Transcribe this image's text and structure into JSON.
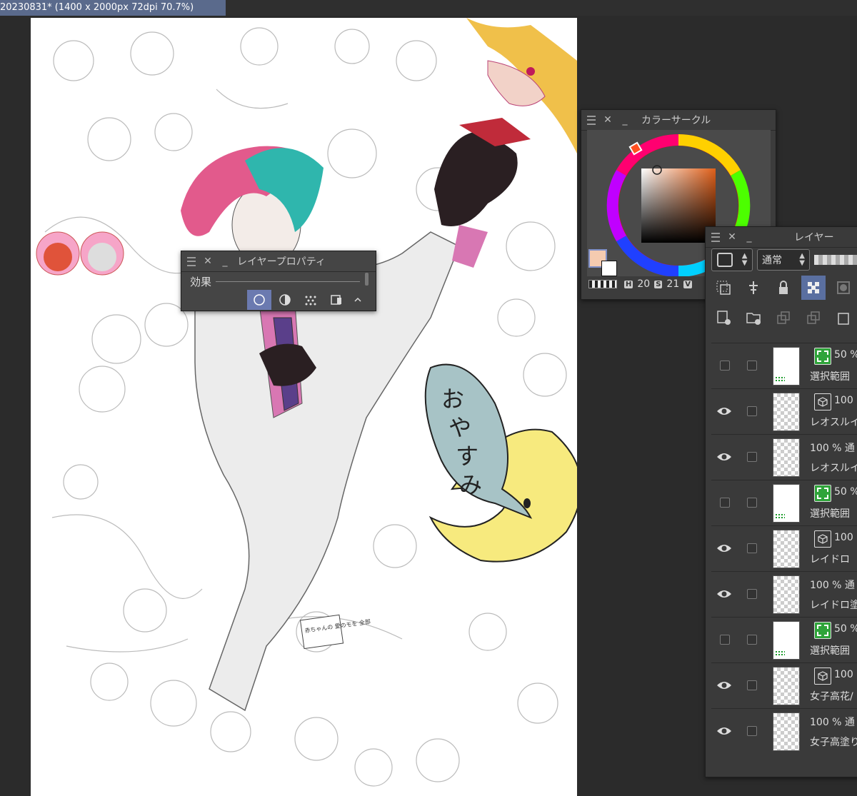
{
  "document": {
    "tab_title": "20230831* (1400 x 2000px 72dpi 70.7%)"
  },
  "canvas": {
    "speech_bubble_text": [
      "お",
      "や",
      "す",
      "み"
    ],
    "sign_text": "赤ちゃんの 愛のモを 全部"
  },
  "layer_property": {
    "title": "レイヤープロパティ",
    "effect_label": "効果",
    "effect_icons": [
      "border-effect-icon",
      "tone-effect-icon",
      "halftone-icon",
      "layer-color-icon"
    ]
  },
  "color_circle": {
    "title": "カラーサークル",
    "main_color": "#f5cbb0",
    "sub_color": "#ffffff",
    "h_letter": "H",
    "h_value": "20",
    "s_letter": "S",
    "s_value": "21",
    "v_letter": "V"
  },
  "layers": {
    "title": "レイヤー",
    "blend_mode": "通常",
    "rows": [
      {
        "visible": false,
        "thumb": "white",
        "mark": "selection",
        "opacity": "50 %",
        "name": "選択範囲"
      },
      {
        "visible": true,
        "thumb": "checker",
        "mark": "3d",
        "opacity": "100",
        "name": "レオスルイ"
      },
      {
        "visible": true,
        "thumb": "checker",
        "mark": "none",
        "opacity": "100 % 通",
        "name": "レオスルイス"
      },
      {
        "visible": false,
        "thumb": "white",
        "mark": "selection",
        "opacity": "50 %",
        "name": "選択範囲"
      },
      {
        "visible": true,
        "thumb": "checker",
        "mark": "3d",
        "opacity": "100",
        "name": "レイドロ"
      },
      {
        "visible": true,
        "thumb": "checker",
        "mark": "none",
        "opacity": "100 % 通",
        "name": "レイドロ塗"
      },
      {
        "visible": false,
        "thumb": "white",
        "mark": "selection",
        "opacity": "50 %",
        "name": "選択範囲"
      },
      {
        "visible": true,
        "thumb": "checker",
        "mark": "3d",
        "opacity": "100",
        "name": "女子高花/"
      },
      {
        "visible": true,
        "thumb": "checker",
        "mark": "none",
        "opacity": "100 % 通",
        "name": "女子高塗り"
      }
    ]
  }
}
